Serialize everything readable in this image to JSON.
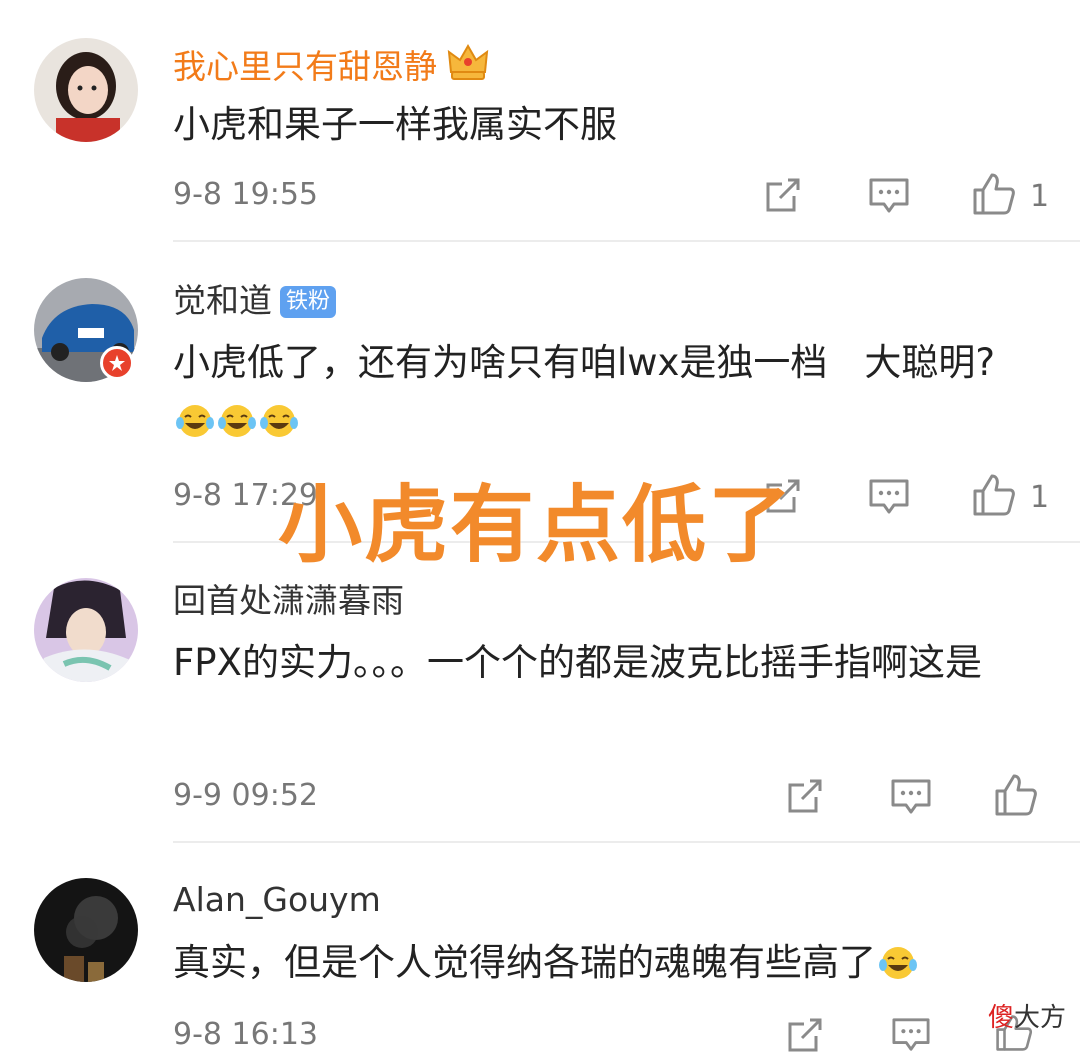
{
  "comments": [
    {
      "username": "我心里只有甜恩静",
      "text": "小虎和果子一样我属实不服",
      "time": "9-8 19:55",
      "like_count": "1"
    },
    {
      "username": "觉和道",
      "fan_badge": "铁粉",
      "text": "小虎低了，还有为啥只有咱lwx是独一档　大聪明?",
      "time": "9-8 17:29",
      "like_count": "1"
    },
    {
      "username": "回首处潇潇暮雨",
      "text": "FPX的实力。。。一个个的都是波克比摇手指啊这是",
      "time": "9-9 09:52",
      "like_count": ""
    },
    {
      "username": "Alan_Gouym",
      "text": "真实，但是个人觉得纳各瑞的魂魄有些高了",
      "time": "9-8 16:13",
      "like_count": ""
    }
  ],
  "overlay_caption": "小虎有点低了",
  "watermark": {
    "part1": "傻",
    "part2": "大方"
  },
  "colors": {
    "vip_name": "#f27b19",
    "overlay": "#f28a2b",
    "fan_badge_bg": "#5fa1f0",
    "icon_gray": "#8a8a8a"
  },
  "icons": [
    "share-icon",
    "comment-icon",
    "like-icon",
    "crown-icon",
    "laugh-cry-emoji"
  ]
}
